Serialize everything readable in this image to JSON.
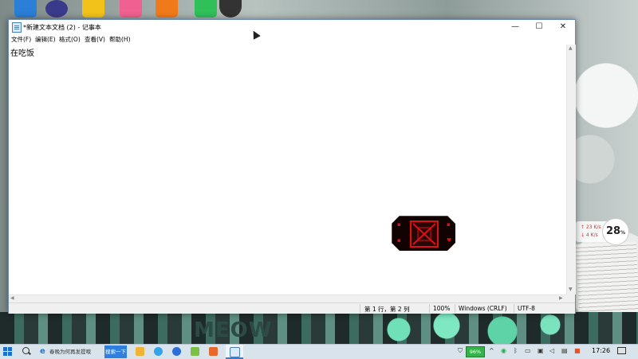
{
  "window": {
    "title": "*新建文本文档 (2) - 记事本",
    "controls": {
      "minimize": "—",
      "maximize": "☐",
      "close": "✕"
    }
  },
  "menu": {
    "file": "文件(F)",
    "edit": "编辑(E)",
    "format": "格式(O)",
    "view": "查看(V)",
    "help": "帮助(H)"
  },
  "editor": {
    "content": "在吃饭"
  },
  "status": {
    "position": "第 1 行，第 2 列",
    "zoom": "100%",
    "line_ending": "Windows (CRLF)",
    "encoding": "UTF-8"
  },
  "desktop": {
    "weather": {
      "up": "↑ 23 K/s",
      "down": "↓ 4 K/s",
      "temperature": "28",
      "unit": "%"
    },
    "wallpaper_text": "MEOW"
  },
  "taskbar": {
    "search_text": "春晚为何再发提哦",
    "search_button": "搜索一下",
    "battery": "96%",
    "time": "17:26"
  },
  "colors": {
    "accent": "#2f7fe0",
    "battery": "#34b34a",
    "widget_red": "#d11111"
  }
}
